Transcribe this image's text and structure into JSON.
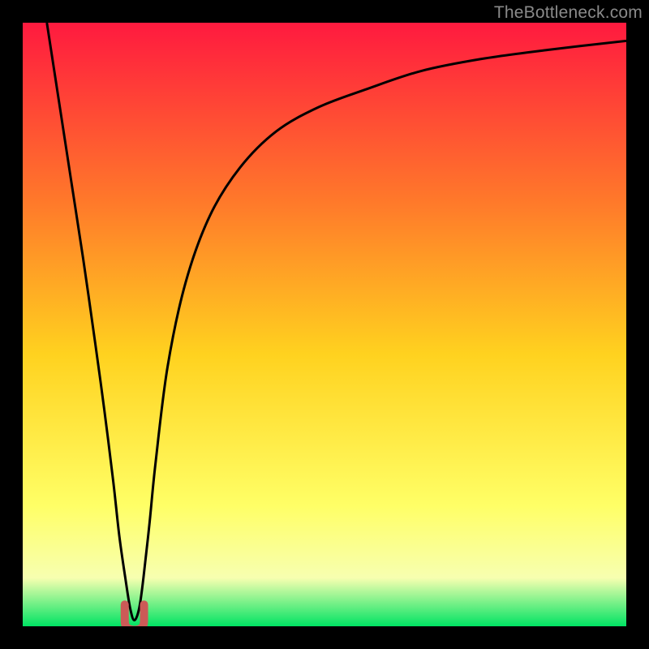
{
  "watermark": "TheBottleneck.com",
  "colors": {
    "gradient_top": "#ff1a3f",
    "gradient_mid1": "#ff7a2a",
    "gradient_mid2": "#ffd21f",
    "gradient_mid3": "#ffff66",
    "gradient_band": "#f7ffb0",
    "gradient_bottom": "#00e363",
    "curve": "#000000",
    "marker": "#cc5a57",
    "frame": "#000000"
  },
  "chart_data": {
    "type": "line",
    "title": "",
    "xlabel": "",
    "ylabel": "",
    "xlim": [
      0,
      100
    ],
    "ylim": [
      0,
      100
    ],
    "series": [
      {
        "name": "bottleneck-curve",
        "x": [
          4,
          6,
          8,
          10,
          12,
          13.5,
          15,
          16,
          17,
          17.8,
          18.5,
          19.3,
          20,
          21,
          22,
          24,
          27,
          31,
          36,
          42,
          49,
          57,
          66,
          76,
          87,
          100
        ],
        "y": [
          100,
          87,
          74,
          61,
          47,
          36,
          24,
          15,
          8,
          3,
          1,
          3,
          8,
          17,
          27,
          43,
          57,
          68,
          76,
          82,
          86,
          89,
          92,
          94,
          95.5,
          97
        ]
      }
    ],
    "marker": {
      "name": "optimal-point-u-shape",
      "x": 18.5,
      "y": 1.5,
      "width_pct": 3.2,
      "height_pct": 4.2
    },
    "green_band_top_pct": 92
  }
}
